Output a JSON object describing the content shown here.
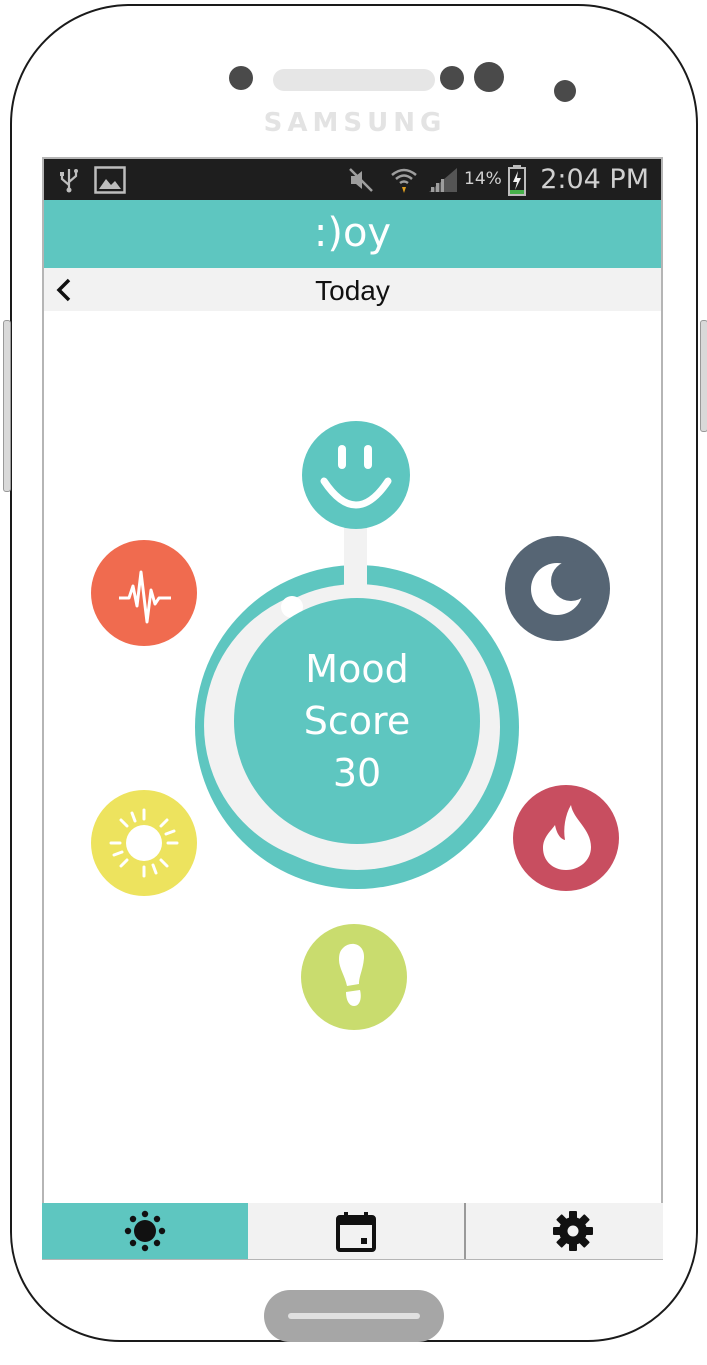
{
  "device": {
    "brand": "SAMSUNG",
    "body_color": "#ffffff",
    "outline_color": "#1a1a1a"
  },
  "status_bar": {
    "battery": "14%",
    "time": "2:04 PM",
    "icons": [
      "usb-icon",
      "image-icon",
      "mute-icon",
      "wifi-icon",
      "signal-icon",
      "battery-charging-icon"
    ]
  },
  "app_bar": {
    "logo": ":)oy",
    "color": "#5ec6c0"
  },
  "sub_bar": {
    "title": "Today",
    "back_icon": "chevron-left-icon"
  },
  "mood": {
    "label_line1": "Mood",
    "label_line2": "Score",
    "score": "30",
    "progress": 0.92,
    "accent": "#5ec6c0"
  },
  "categories": [
    {
      "name": "mood",
      "icon": "smiley-icon",
      "color": "#5ec6c0"
    },
    {
      "name": "activity",
      "icon": "heartbeat-icon",
      "color": "#f06b4f"
    },
    {
      "name": "sleep",
      "icon": "moon-icon",
      "color": "#566574"
    },
    {
      "name": "sun",
      "icon": "sun-icon",
      "color": "#ede35e"
    },
    {
      "name": "calories",
      "icon": "flame-icon",
      "color": "#c84e60"
    },
    {
      "name": "steps",
      "icon": "footprint-icon",
      "color": "#c9dc6e"
    }
  ],
  "bottom_nav": {
    "tabs": [
      {
        "name": "today",
        "icon": "sun-icon",
        "active": true
      },
      {
        "name": "calendar",
        "icon": "calendar-icon",
        "active": false
      },
      {
        "name": "settings",
        "icon": "gear-icon",
        "active": false
      }
    ],
    "active_color": "#5ec6c0",
    "inactive_color": "#f2f2f2"
  }
}
